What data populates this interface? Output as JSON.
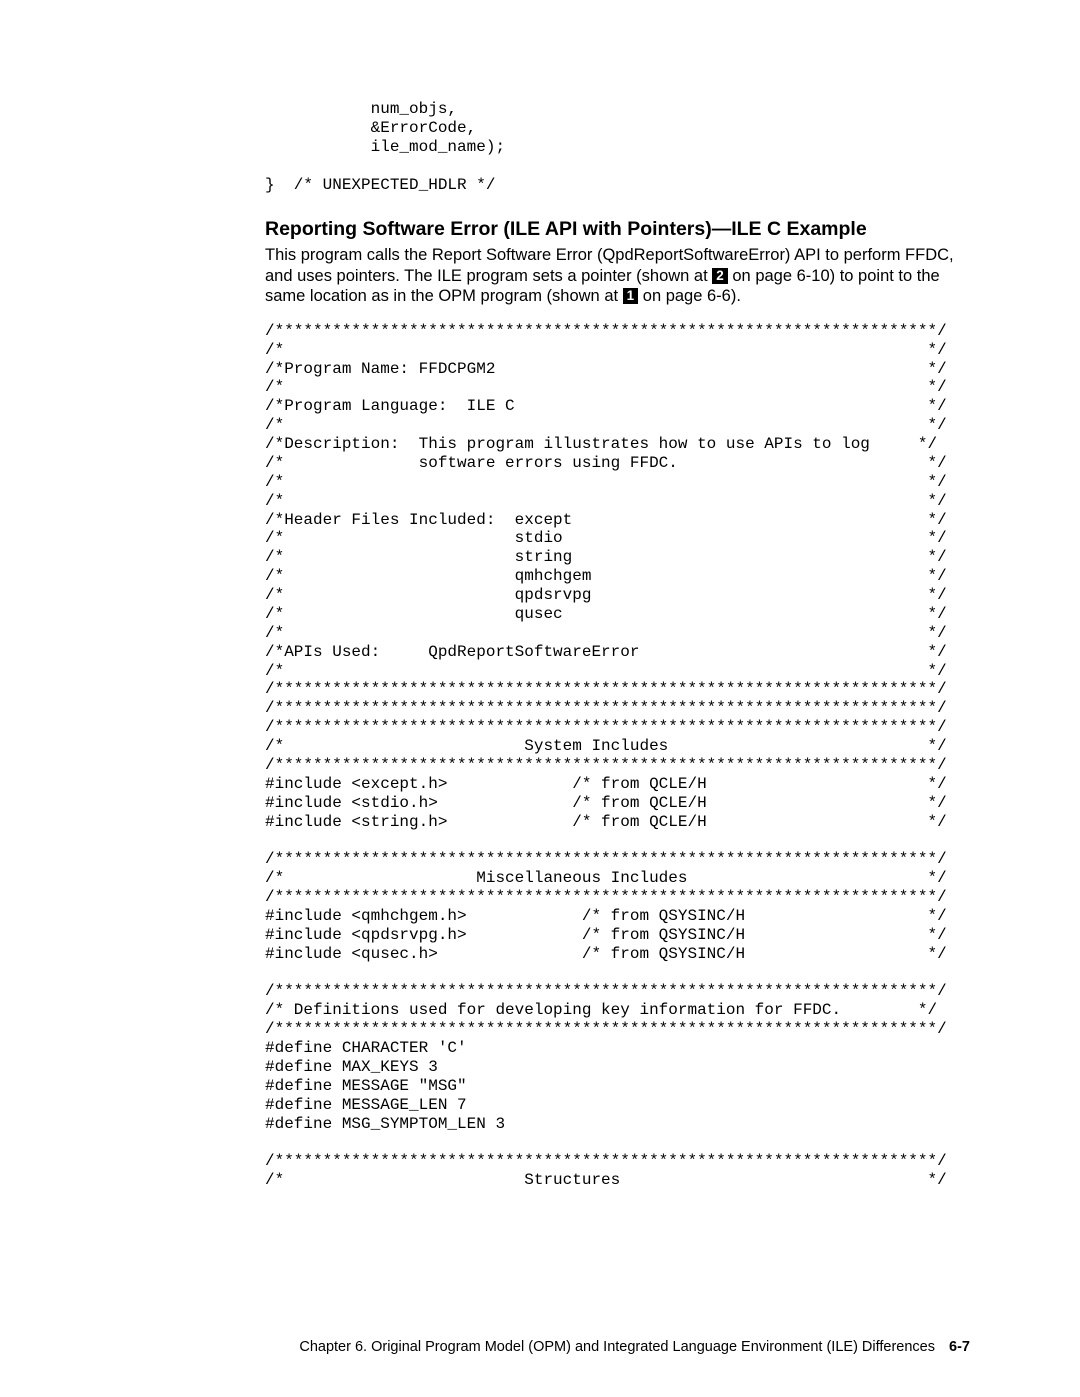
{
  "codeTop": "           num_objs,\n           &ErrorCode,\n           ile_mod_name);\n\n}  /* UNEXPECTED_HDLR */",
  "heading": "Reporting Software Error (ILE API with Pointers)—ILE C Example",
  "intro1": "This program calls the Report Software Error (QpdReportSoftwareError) API to perform FFDC, and uses pointers.  The ILE program sets a pointer (shown at ",
  "ref2": "2",
  "intro2": " on page 6-10) to point to the same location as in the OPM program (shown at ",
  "ref1": "1",
  "intro3": " on page 6-6).",
  "codeMain": "/*********************************************************************/\n/*                                                                   */\n/*Program Name: FFDCPGM2                                             */\n/*                                                                   */\n/*Program Language:  ILE C                                           */\n/*                                                                   */\n/*Description:  This program illustrates how to use APIs to log     */\n/*              software errors using FFDC.                          */\n/*                                                                   */\n/*                                                                   */\n/*Header Files Included:  except                                     */\n/*                        stdio                                      */\n/*                        string                                     */\n/*                        qmhchgem                                   */\n/*                        qpdsrvpg                                   */\n/*                        qusec                                      */\n/*                                                                   */\n/*APIs Used:     QpdReportSoftwareError                              */\n/*                                                                   */\n/*********************************************************************/\n/*********************************************************************/\n/*********************************************************************/\n/*                         System Includes                           */\n/*********************************************************************/\n#include <except.h>             /* from QCLE/H                       */\n#include <stdio.h>              /* from QCLE/H                       */\n#include <string.h>             /* from QCLE/H                       */\n\n/*********************************************************************/\n/*                    Miscellaneous Includes                         */\n/*********************************************************************/\n#include <qmhchgem.h>            /* from QSYSINC/H                   */\n#include <qpdsrvpg.h>            /* from QSYSINC/H                   */\n#include <qusec.h>               /* from QSYSINC/H                   */\n\n/*********************************************************************/\n/* Definitions used for developing key information for FFDC.        */\n/*********************************************************************/\n#define CHARACTER 'C'\n#define MAX_KEYS 3\n#define MESSAGE \"MSG\"\n#define MESSAGE_LEN 7\n#define MSG_SYMPTOM_LEN 3\n\n/*********************************************************************/\n/*                         Structures                                */",
  "footer": {
    "chapter": "Chapter 6. Original Program Model (OPM) and Integrated Language Environment (ILE) Differences",
    "pagenum": "6-7"
  }
}
